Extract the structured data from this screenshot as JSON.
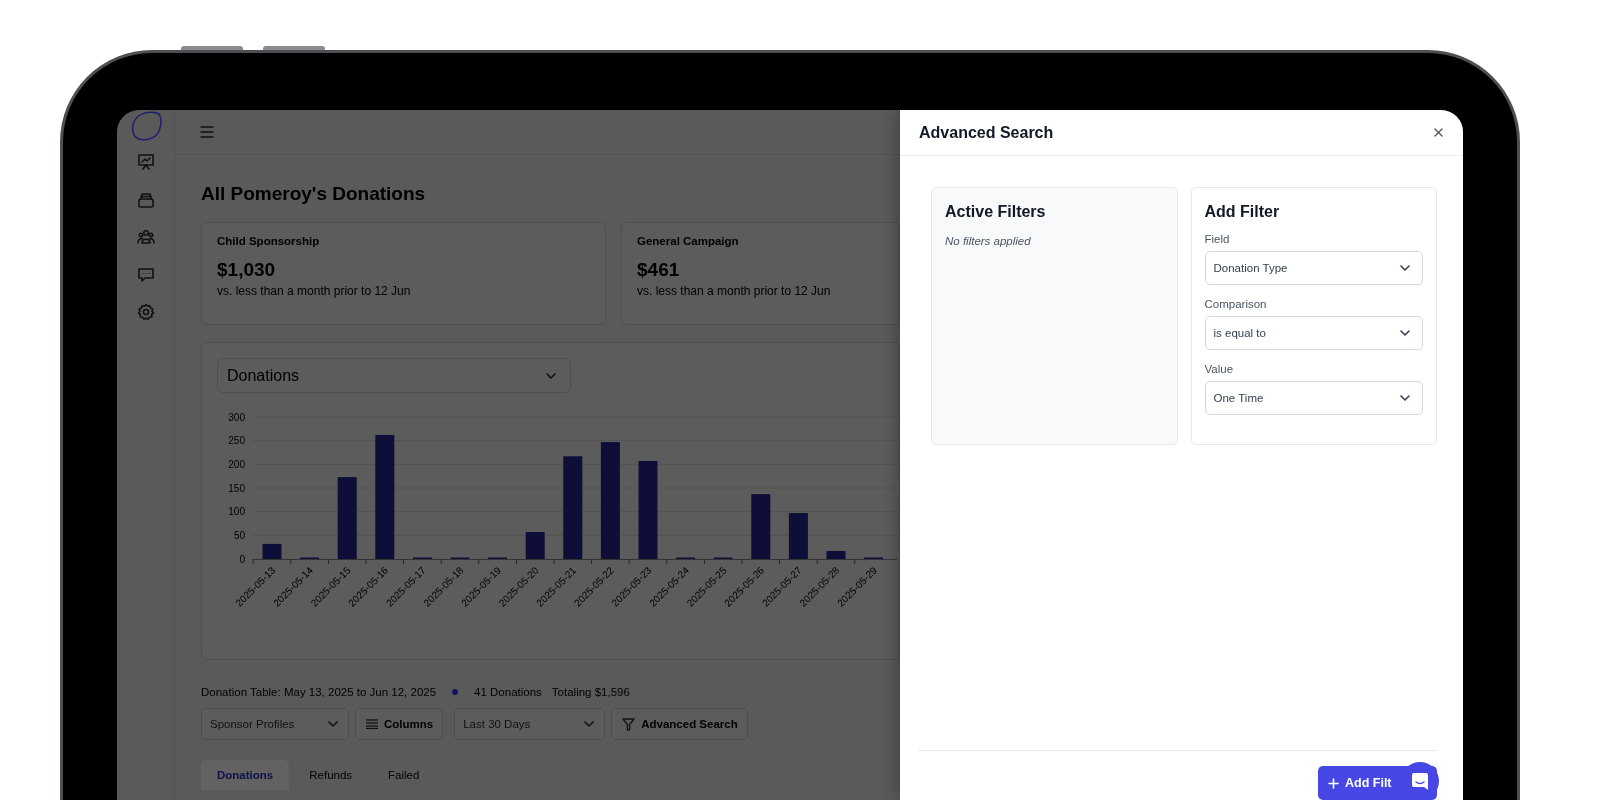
{
  "page_title": "All Pomeroy's Donations",
  "stat_cards": [
    {
      "title": "Child Sponsorship",
      "amount": "$1,030",
      "comparison": "vs. less than a month prior to 12 Jun"
    },
    {
      "title": "General Campaign",
      "amount": "$461",
      "comparison": "vs. less than a month prior to 12 Jun"
    }
  ],
  "chart_panel": {
    "metric_select": "Donations",
    "chart_data": {
      "type": "bar",
      "categories": [
        "2025-05-13",
        "2025-05-14",
        "2025-05-15",
        "2025-05-16",
        "2025-05-17",
        "2025-05-18",
        "2025-05-19",
        "2025-05-20",
        "2025-05-21",
        "2025-05-22",
        "2025-05-23",
        "2025-05-24",
        "2025-05-25",
        "2025-05-26",
        "2025-05-27",
        "2025-05-28",
        "2025-05-29"
      ],
      "values": [
        32,
        0,
        173,
        262,
        0,
        0,
        0,
        57,
        217,
        247,
        207,
        0,
        0,
        137,
        97,
        17,
        0
      ],
      "ylim": [
        0,
        300
      ],
      "yticks": [
        0,
        50,
        100,
        150,
        200,
        250,
        300
      ],
      "grid": true
    }
  },
  "summary": {
    "range": "Donation Table: May 13, 2025 to Jun 12, 2025",
    "count": "41 Donations",
    "total": "Totaling $1,596"
  },
  "toolbar": {
    "profile_select": {
      "placeholder": "Sponsor Profiles"
    },
    "columns_button": "Columns",
    "date_select": {
      "placeholder": "Last 30 Days"
    },
    "advanced_search_button": "Advanced Search"
  },
  "tabs": [
    {
      "label": "Donations",
      "selected": true
    },
    {
      "label": "Refunds",
      "selected": false
    },
    {
      "label": "Failed",
      "selected": false
    }
  ],
  "drawer": {
    "title": "Advanced Search",
    "active_filters": {
      "title": "Active Filters",
      "empty_text": "No filters applied"
    },
    "add_filter": {
      "title": "Add Filter",
      "fields": [
        {
          "label": "Field",
          "value": "Donation Type"
        },
        {
          "label": "Comparison",
          "value": "is equal to"
        },
        {
          "label": "Value",
          "value": "One Time"
        }
      ]
    },
    "submit_button": "Add Filt"
  }
}
